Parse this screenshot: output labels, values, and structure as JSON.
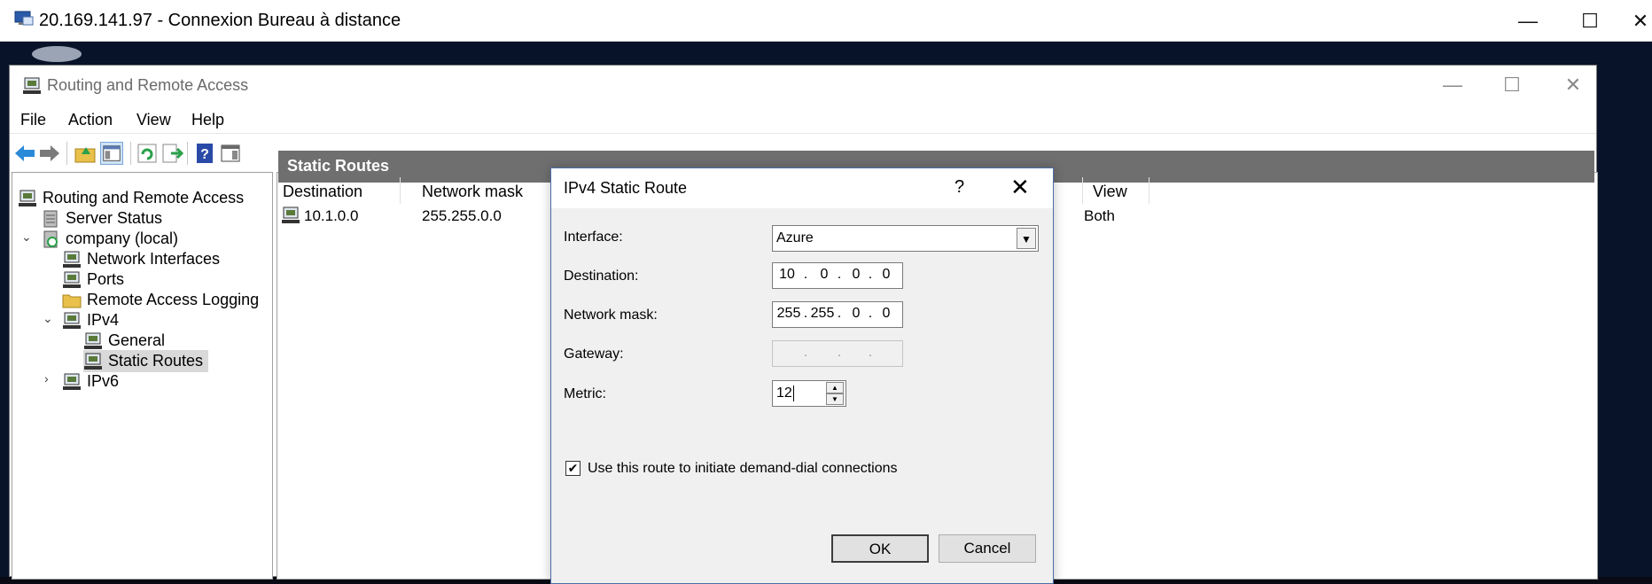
{
  "rdp": {
    "title": "20.169.141.97 - Connexion Bureau à distance",
    "minimize": "—",
    "maximize": "☐",
    "close": "✕"
  },
  "rras": {
    "title": "Routing and Remote Access",
    "menu": [
      "File",
      "Action",
      "View",
      "Help"
    ],
    "tree": [
      {
        "label": "Routing and Remote Access"
      },
      {
        "label": "Server Status"
      },
      {
        "label": "company (local)"
      },
      {
        "label": "Network Interfaces"
      },
      {
        "label": "Ports"
      },
      {
        "label": "Remote Access Logging"
      },
      {
        "label": "IPv4"
      },
      {
        "label": "General"
      },
      {
        "label": "Static Routes"
      },
      {
        "label": "IPv6"
      }
    ],
    "pane_title": "Static Routes",
    "columns": [
      "Destination",
      "Network mask",
      "View"
    ],
    "rows": [
      {
        "destination": "10.1.0.0",
        "mask": "255.255.0.0",
        "view": "Both"
      }
    ]
  },
  "dialog": {
    "title": "IPv4 Static Route",
    "help": "?",
    "close": "✕",
    "interface_label": "Interface:",
    "interface_value": "Azure",
    "destination_label": "Destination:",
    "destination": [
      "10",
      "0",
      "0",
      "0"
    ],
    "mask_label": "Network mask:",
    "mask": [
      "255",
      "255",
      "0",
      "0"
    ],
    "gateway_label": "Gateway:",
    "gateway": [
      "",
      "",
      "",
      ""
    ],
    "metric_label": "Metric:",
    "metric_value": "12",
    "checkbox_label": "Use this route to initiate demand-dial connections",
    "checkbox_checked": true,
    "ok_label": "OK",
    "cancel_label": "Cancel"
  }
}
